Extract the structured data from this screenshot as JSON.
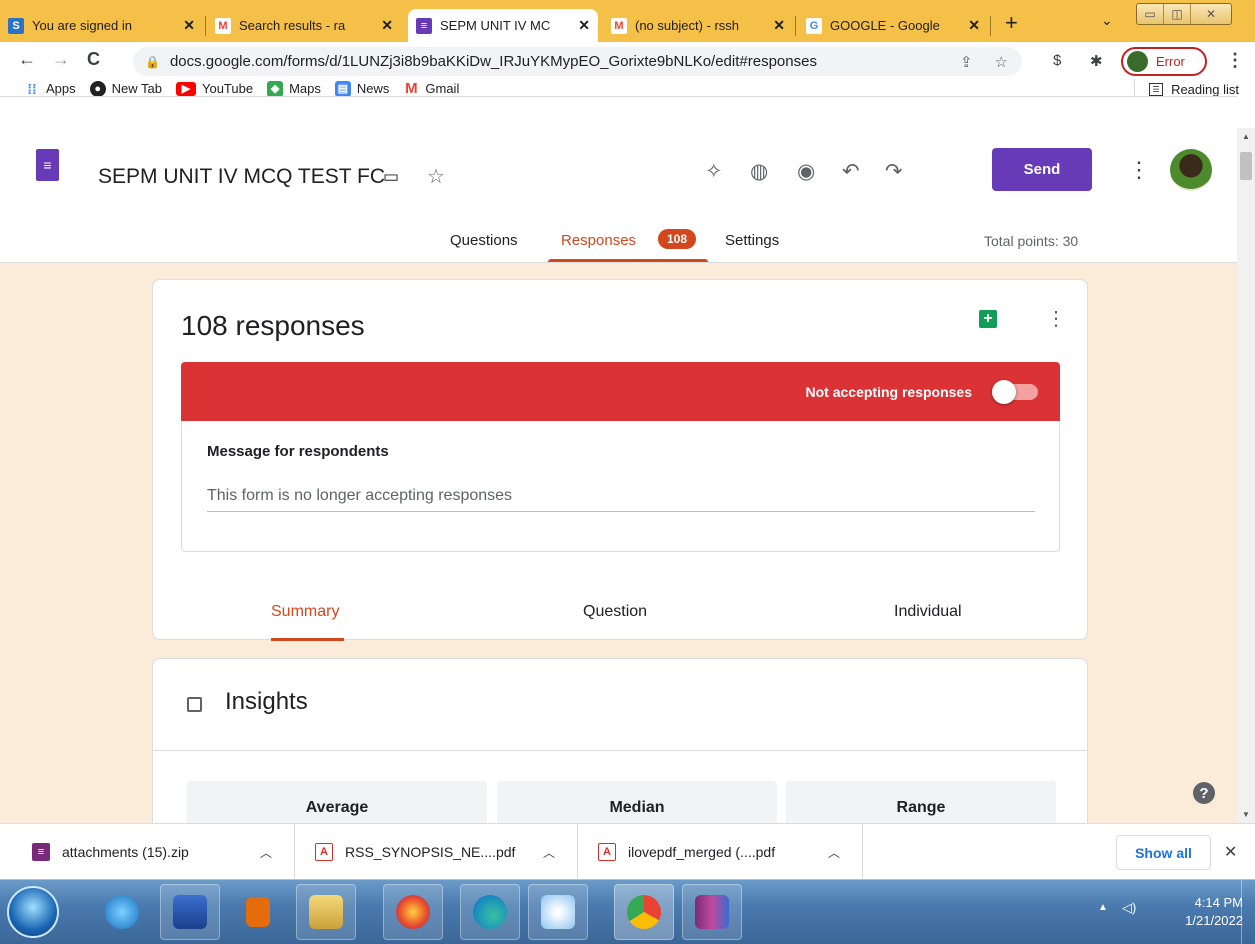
{
  "browser": {
    "tabs": [
      {
        "title": "You are signed in",
        "favicon": "S",
        "color": "#2a73c4"
      },
      {
        "title": "Search results - ra",
        "favicon": "M",
        "color": "#ea4335"
      },
      {
        "title": "SEPM UNIT IV MC",
        "favicon": "≡",
        "color": "#673ab7"
      },
      {
        "title": "(no subject) - rssh",
        "favicon": "M",
        "color": "#ea4335"
      },
      {
        "title": "GOOGLE - Google",
        "favicon": "G",
        "color": "#4285f4"
      }
    ],
    "url": "docs.google.com/forms/d/1LUNZj3i8b9baKKiDw_IRJuYKMypEO_Gorixte9bNLKo/edit#responses",
    "profile_label": "Error",
    "bookmarks": [
      {
        "label": "Apps",
        "icon": "apps-grid-icon",
        "color": "#4285f4"
      },
      {
        "label": "New Tab",
        "icon": "globe-icon",
        "color": "#202124"
      },
      {
        "label": "YouTube",
        "icon": "youtube-icon",
        "color": "#ff0000"
      },
      {
        "label": "Maps",
        "icon": "maps-icon",
        "color": "#34a853"
      },
      {
        "label": "News",
        "icon": "news-icon",
        "color": "#4285f4"
      },
      {
        "label": "Gmail",
        "icon": "gmail-icon",
        "color": "#ea4335"
      }
    ],
    "reading_list": "Reading list"
  },
  "form": {
    "title": "SEPM UNIT IV MCQ TEST FC",
    "send_label": "Send",
    "tabs": {
      "questions": "Questions",
      "responses": "Responses",
      "responses_count": "108",
      "settings": "Settings"
    },
    "total_points": "Total points: 30",
    "accent_color": "#673ab7",
    "response_color": "#d2471d"
  },
  "responses": {
    "heading": "108 responses",
    "status_text": "Not accepting responses",
    "accepting": false,
    "banner_color": "#db3236",
    "message_label": "Message for respondents",
    "message_text": "This form is no longer accepting responses",
    "subtabs": {
      "summary": "Summary",
      "question": "Question",
      "individual": "Individual"
    }
  },
  "insights": {
    "title": "Insights",
    "stats": [
      {
        "label": "Average"
      },
      {
        "label": "Median"
      },
      {
        "label": "Range"
      }
    ]
  },
  "downloads": {
    "items": [
      {
        "name": "attachments (15).zip",
        "icon": "winrar-icon"
      },
      {
        "name": "RSS_SYNOPSIS_NE....pdf",
        "icon": "pdf-icon"
      },
      {
        "name": "ilovepdf_merged (....pdf",
        "icon": "pdf-icon"
      }
    ],
    "show_all": "Show all"
  },
  "taskbar": {
    "time": "4:14 PM",
    "date": "1/21/2022"
  }
}
